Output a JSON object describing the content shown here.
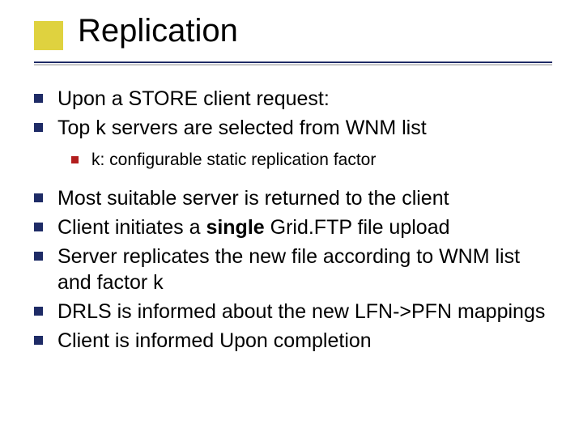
{
  "title": "Replication",
  "bullets": {
    "b0": "Upon a STORE client request:",
    "b1": "Top k servers are selected from WNM list",
    "b1_sub": "k: configurable static replication factor",
    "b2": "Most suitable server is returned to the client",
    "b3_pre": "Client initiates a ",
    "b3_bold": "single",
    "b3_post": " Grid.FTP file upload",
    "b4": " Server replicates the new file according to WNM list and factor k",
    "b5": "DRLS is informed about the new LFN->PFN mappings",
    "b6": "Client is informed Upon completion"
  }
}
